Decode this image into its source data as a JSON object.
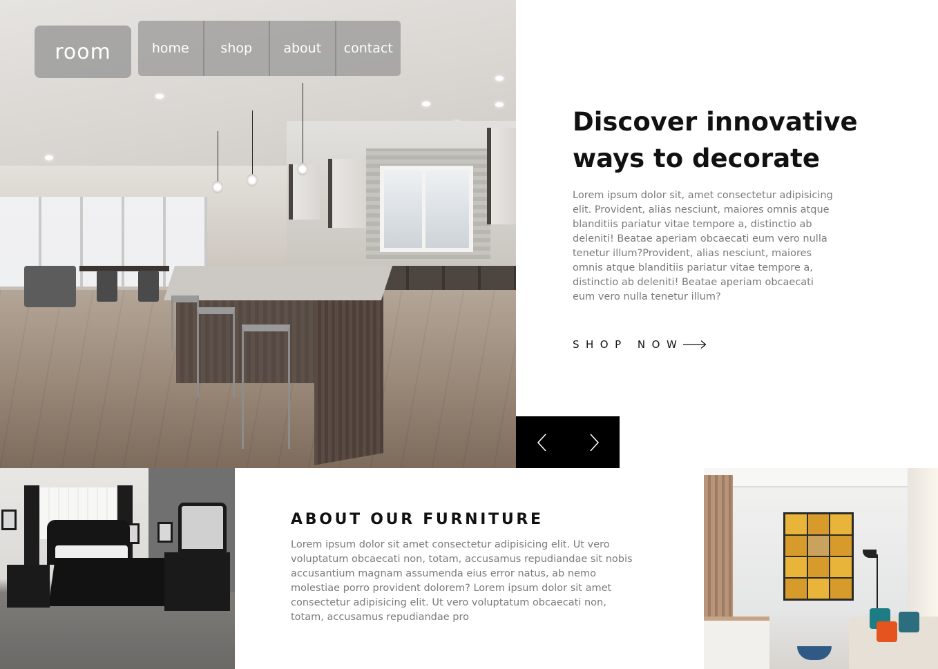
{
  "brand": {
    "logo_text": "room"
  },
  "nav": {
    "items": [
      {
        "label": "home"
      },
      {
        "label": "shop"
      },
      {
        "label": "about"
      },
      {
        "label": "contact"
      }
    ]
  },
  "hero": {
    "title_line1": "Discover innovative",
    "title_line2": "ways to decorate",
    "description": "Lorem ipsum dolor sit, amet consectetur adipisicing elit. Provident, alias nesciunt, maiores omnis atque blanditiis pariatur vitae tempore a, distinctio ab deleniti! Beatae aperiam obcaecati eum vero nulla tenetur illum?Provident, alias nesciunt, maiores omnis atque blanditiis pariatur vitae tempore a, distinctio ab deleniti! Beatae aperiam obcaecati eum vero nulla tenetur illum?",
    "cta_label": "SHOP NOW",
    "cta_icon": "long-arrow-right-icon"
  },
  "slider": {
    "prev_icon": "chevron-left-icon",
    "next_icon": "chevron-right-icon"
  },
  "about": {
    "title": "ABOUT OUR FURNITURE",
    "description": "Lorem ipsum dolor sit amet consectetur adipisicing elit. Ut vero voluptatum obcaecati non, totam, accusamus repudiandae sit nobis accusantium magnam assumenda eius error natus, ab nemo molestiae porro provident dolorem? Lorem ipsum dolor sit amet consectetur adipisicing elit. Ut vero voluptatum obcaecati non, totam, accusamus repudiandae pro"
  },
  "colors": {
    "nav_background": "#969696",
    "title_text": "#111111",
    "body_text": "#7a7a7a",
    "slider_background": "#000000",
    "page_background": "#ffffff"
  }
}
